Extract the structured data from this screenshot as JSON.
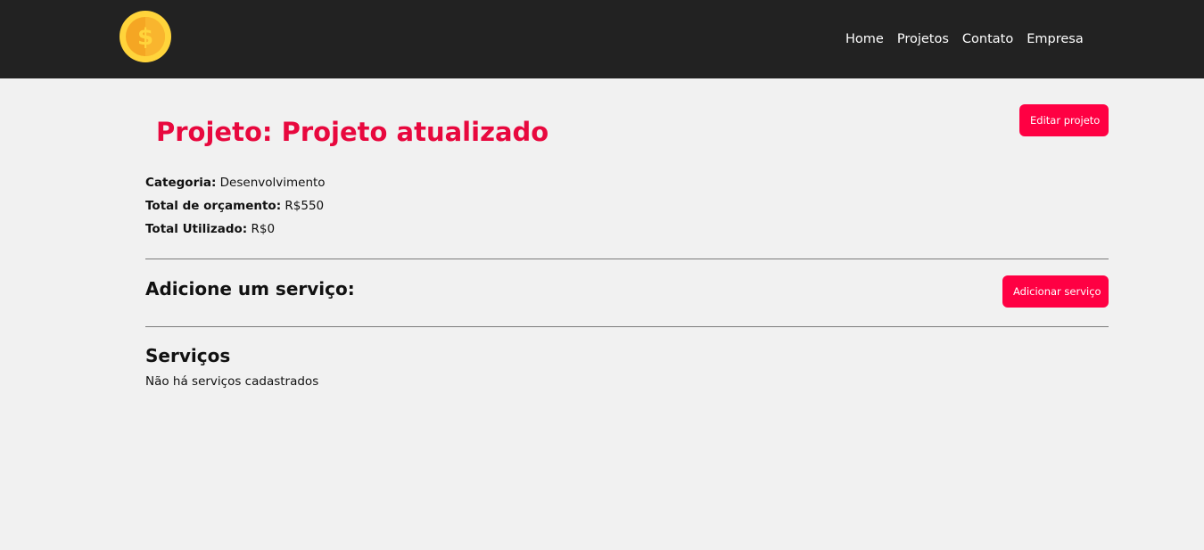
{
  "navbar": {
    "logo_icon": "coin-dollar-icon",
    "links": [
      {
        "label": "Home"
      },
      {
        "label": "Projetos"
      },
      {
        "label": "Contato"
      },
      {
        "label": "Empresa"
      }
    ]
  },
  "project": {
    "title": "Projeto: Projeto atualizado",
    "edit_button": "Editar projeto",
    "category_label": "Categoria:",
    "category_value": "Desenvolvimento",
    "budget_label": "Total de orçamento:",
    "budget_value": "R$550",
    "used_label": "Total Utilizado:",
    "used_value": "R$0"
  },
  "service_form": {
    "title": "Adicione um serviço:",
    "add_button": "Adicionar serviço"
  },
  "services": {
    "title": "Serviços",
    "empty_message": "Não há serviços cadastrados"
  },
  "colors": {
    "navbar_bg": "#222222",
    "page_bg": "#f1f1f1",
    "accent": "#ff0043",
    "title_color": "#e8083e",
    "coin_yellow": "#ffd43b"
  }
}
